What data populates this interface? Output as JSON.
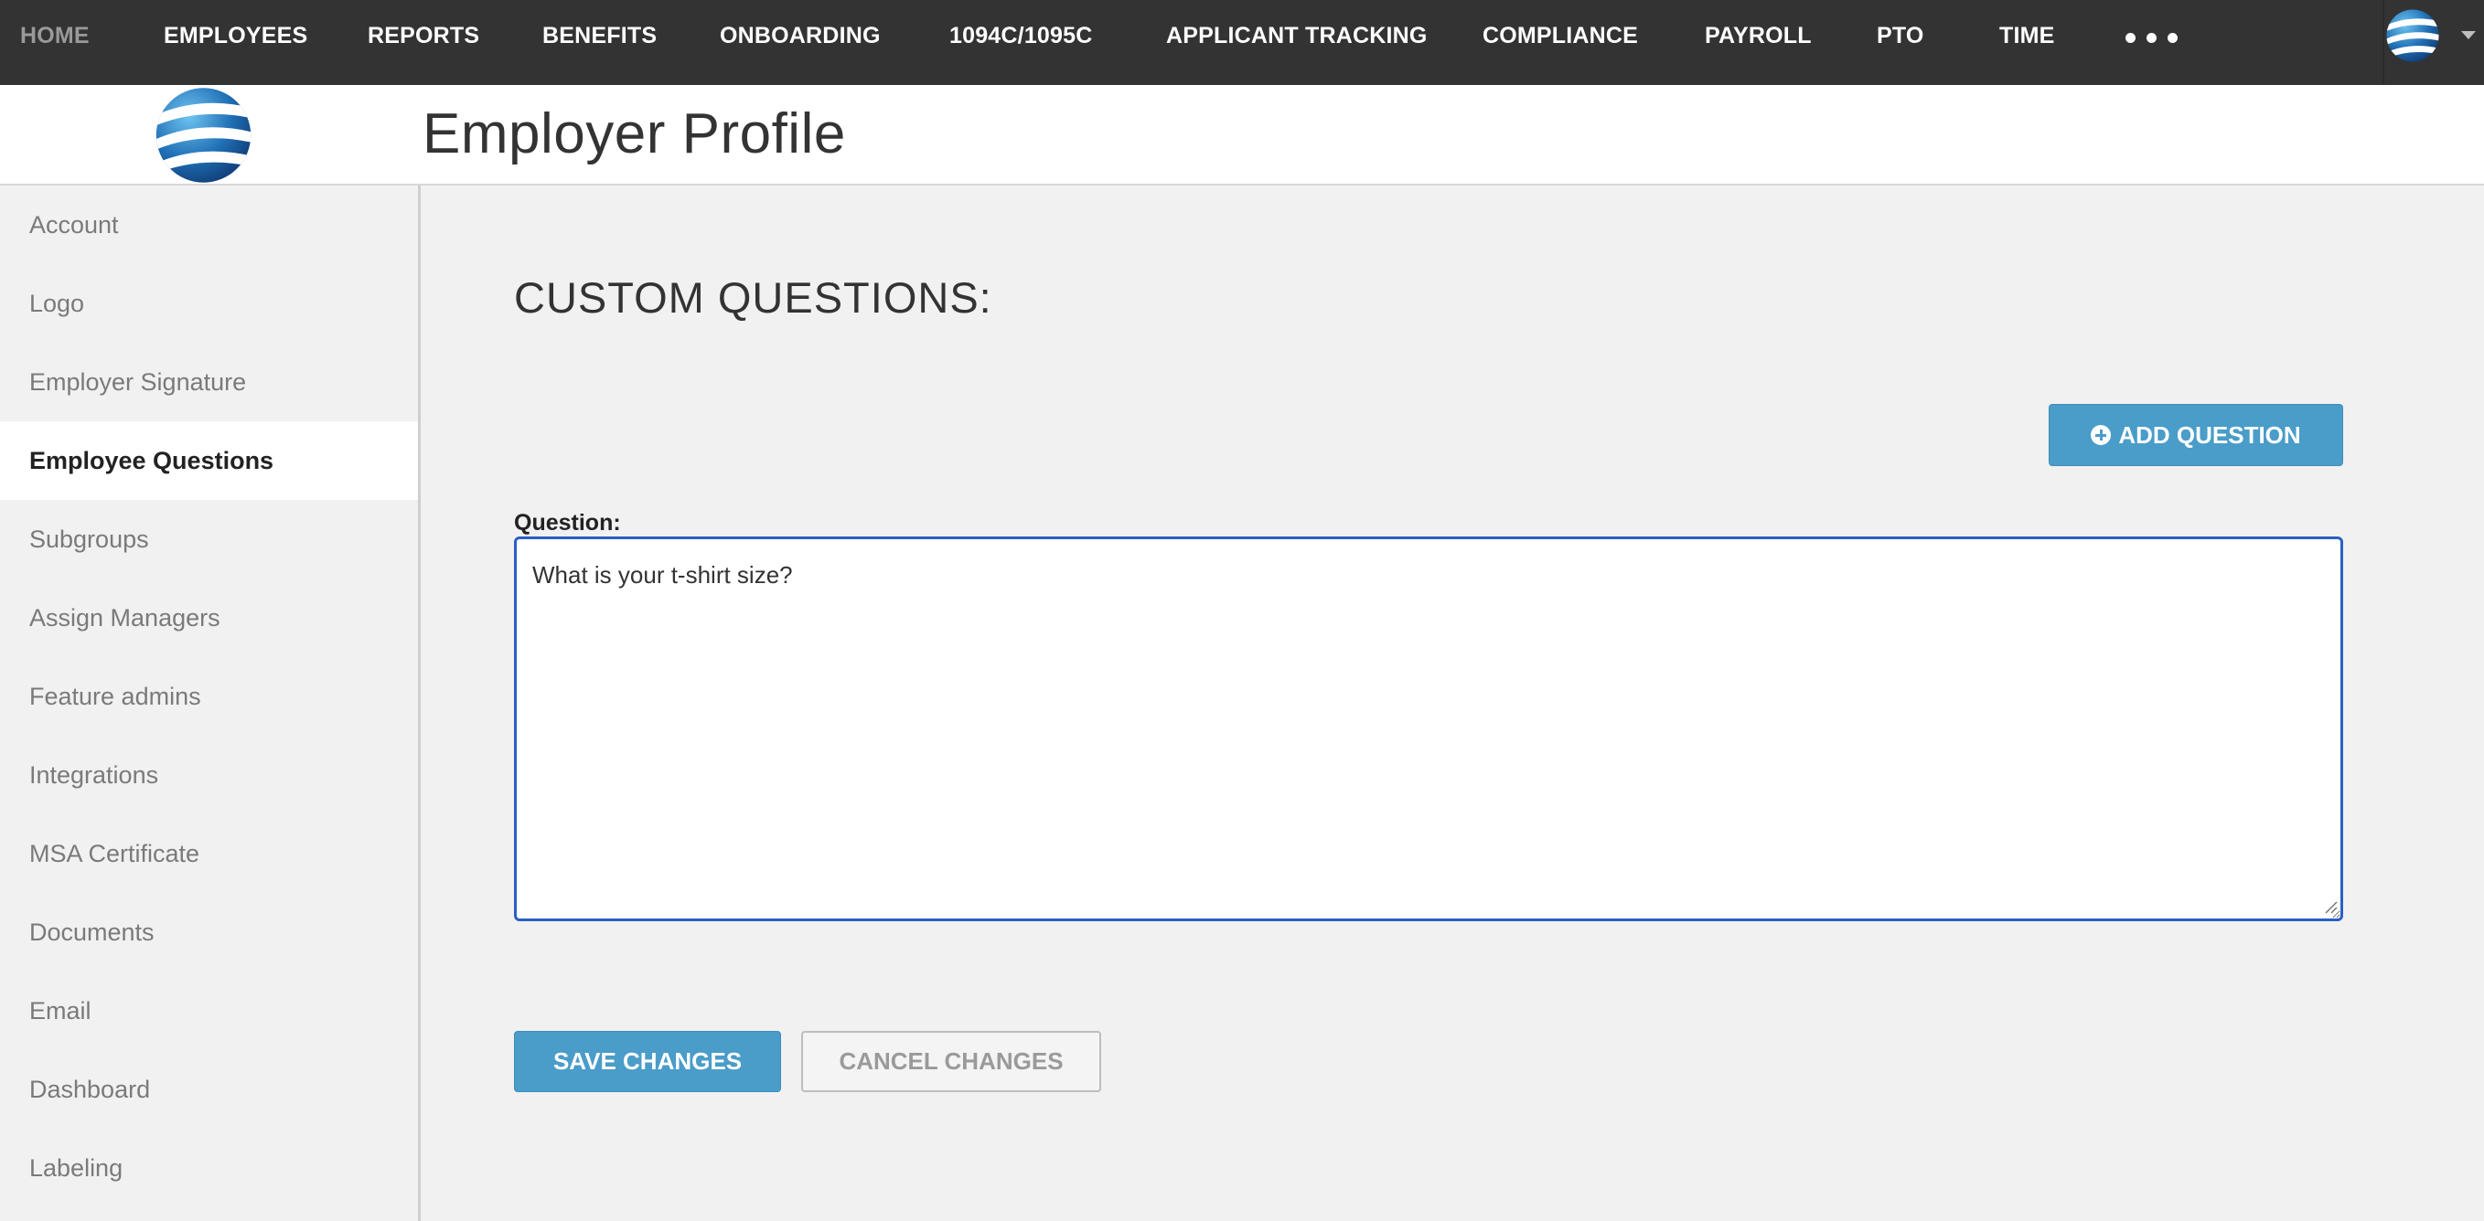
{
  "topnav": {
    "items": [
      {
        "label": "HOME"
      },
      {
        "label": "EMPLOYEES"
      },
      {
        "label": "REPORTS"
      },
      {
        "label": "BENEFITS"
      },
      {
        "label": "ONBOARDING"
      },
      {
        "label": "1094C/1095C"
      },
      {
        "label": "APPLICANT TRACKING"
      },
      {
        "label": "COMPLIANCE"
      },
      {
        "label": "PAYROLL"
      },
      {
        "label": "PTO"
      },
      {
        "label": "TIME"
      }
    ],
    "more_icon": "ellipsis-icon",
    "avatar_icon": "globe-logo-icon"
  },
  "header": {
    "title": "Employer Profile",
    "logo_icon": "globe-logo-icon"
  },
  "sidebar": {
    "items": [
      {
        "label": "Account"
      },
      {
        "label": "Logo"
      },
      {
        "label": "Employer Signature"
      },
      {
        "label": "Employee Questions",
        "active": true
      },
      {
        "label": "Subgroups"
      },
      {
        "label": "Assign Managers"
      },
      {
        "label": "Feature admins"
      },
      {
        "label": "Integrations"
      },
      {
        "label": "MSA Certificate"
      },
      {
        "label": "Documents"
      },
      {
        "label": "Email"
      },
      {
        "label": "Dashboard"
      },
      {
        "label": "Labeling"
      }
    ]
  },
  "main": {
    "section_title": "CUSTOM QUESTIONS:",
    "add_button": "ADD QUESTION",
    "question_label": "Question:",
    "question_value": "What is your t-shirt size?",
    "save_button": "SAVE CHANGES",
    "cancel_button": "CANCEL CHANGES"
  },
  "colors": {
    "nav_bg": "#333333",
    "accent": "#4a9cc9",
    "focus_border": "#2a5fc4"
  }
}
